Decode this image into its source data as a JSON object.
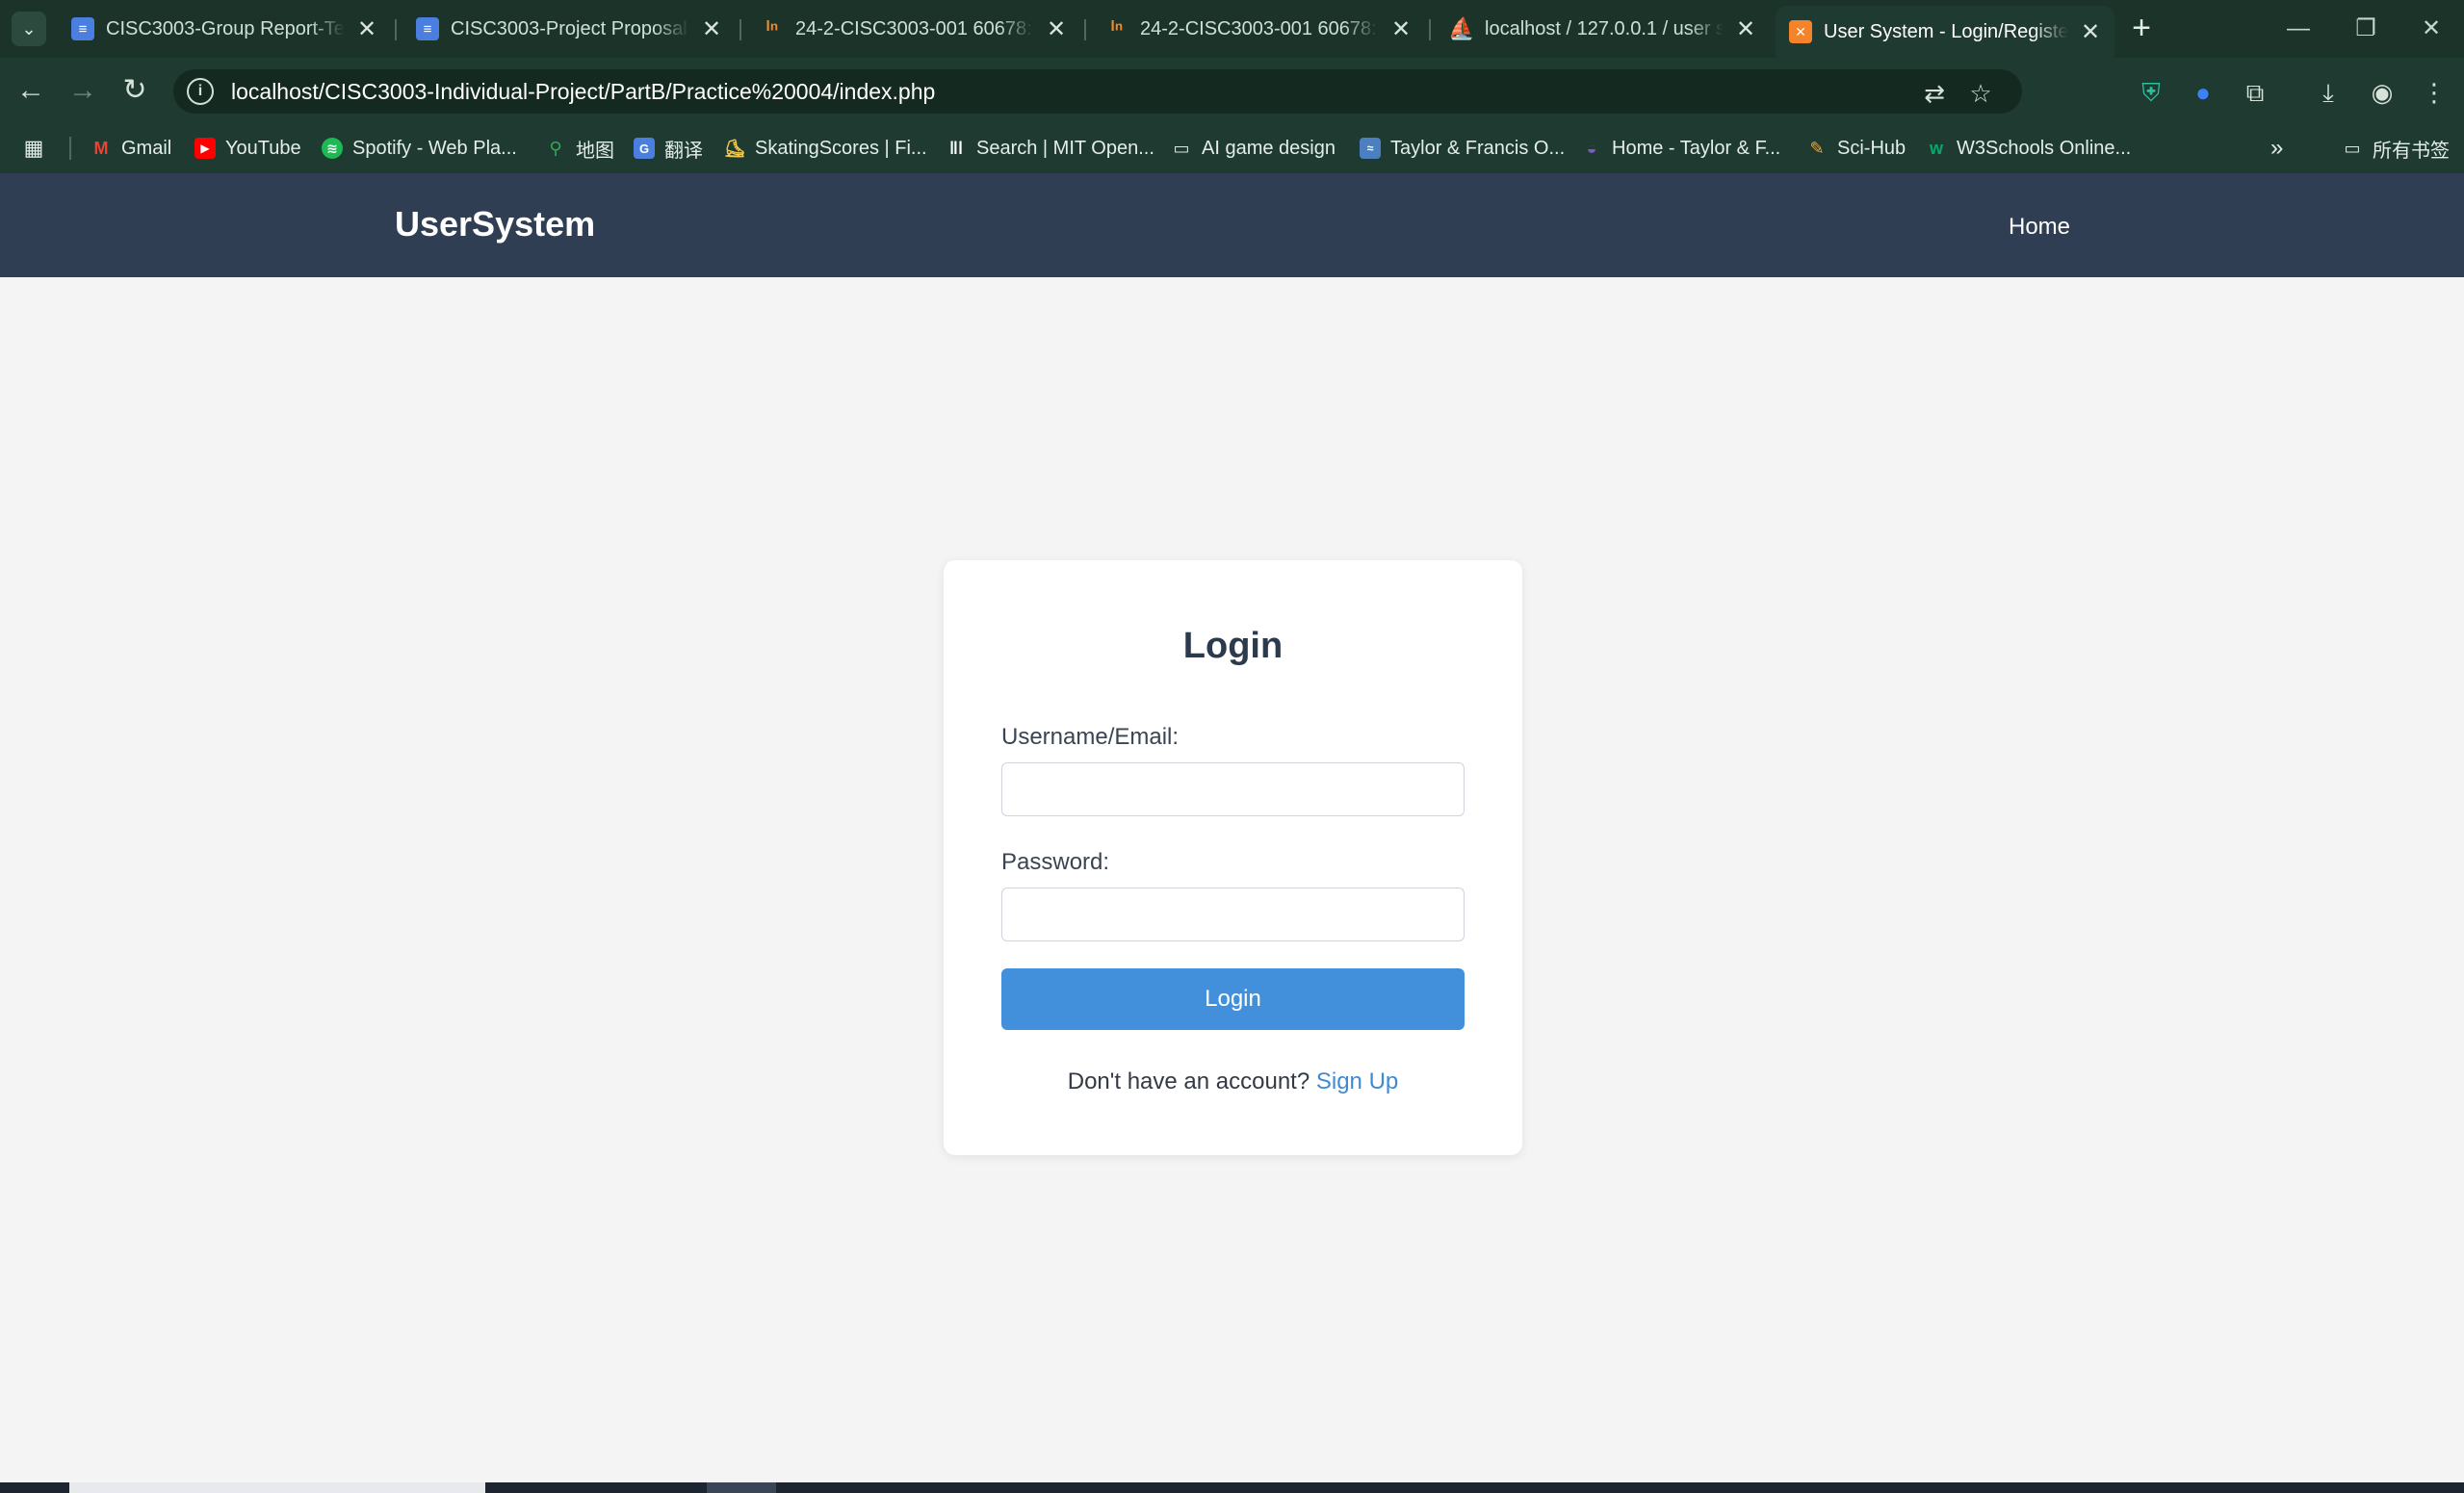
{
  "browser": {
    "tabs": [
      {
        "title": "CISC3003-Group Report-Team",
        "favicon": "docs-icon"
      },
      {
        "title": "CISC3003-Project Proposal-Team",
        "favicon": "docs-icon"
      },
      {
        "title": "24-2-CISC3003-001 60678: Web",
        "favicon": "instructure-icon"
      },
      {
        "title": "24-2-CISC3003-001 60678: Team",
        "favicon": "instructure-icon"
      },
      {
        "title": "localhost / 127.0.0.1 / user sy",
        "favicon": "phpmyadmin-icon"
      },
      {
        "title": "User System - Login/Register",
        "favicon": "xampp-icon",
        "active": true
      }
    ],
    "close_glyph": "✕",
    "new_tab_glyph": "+",
    "url": "localhost/CISC3003-Individual-Project/PartB/Practice%20004/index.php",
    "bookmarks": [
      {
        "label": "Gmail",
        "icon": "gmail-icon"
      },
      {
        "label": "YouTube",
        "icon": "youtube-icon"
      },
      {
        "label": "Spotify - Web Pla...",
        "icon": "spotify-icon"
      },
      {
        "label": "地图",
        "icon": "maps-icon"
      },
      {
        "label": "翻译",
        "icon": "translate-icon"
      },
      {
        "label": "SkatingScores | Fi...",
        "icon": "skating-icon"
      },
      {
        "label": "Search | MIT Open...",
        "icon": "mit-icon"
      },
      {
        "label": "AI game design",
        "icon": "folder-icon"
      },
      {
        "label": "Taylor & Francis O...",
        "icon": "tandf-icon"
      },
      {
        "label": "Home - Taylor & F...",
        "icon": "tandf-home-icon"
      },
      {
        "label": "Sci-Hub",
        "icon": "scihub-icon"
      },
      {
        "label": "W3Schools Online...",
        "icon": "w3schools-icon"
      }
    ],
    "bookmarks_overflow": "»",
    "all_bookmarks": "所有书签"
  },
  "site": {
    "brand": "UserSystem",
    "nav": {
      "home": "Home"
    }
  },
  "login": {
    "title": "Login",
    "username_label": "Username/Email:",
    "username_value": "",
    "password_label": "Password:",
    "password_value": "",
    "submit": "Login",
    "signup_prompt": "Don't have an account?",
    "signup_link": "Sign Up"
  },
  "colors": {
    "navbar": "#2f3e52",
    "button": "#4290dc",
    "link": "#3d8ad6",
    "page_bg": "#f4f4f4",
    "browser_chrome": "#1f3a30"
  }
}
